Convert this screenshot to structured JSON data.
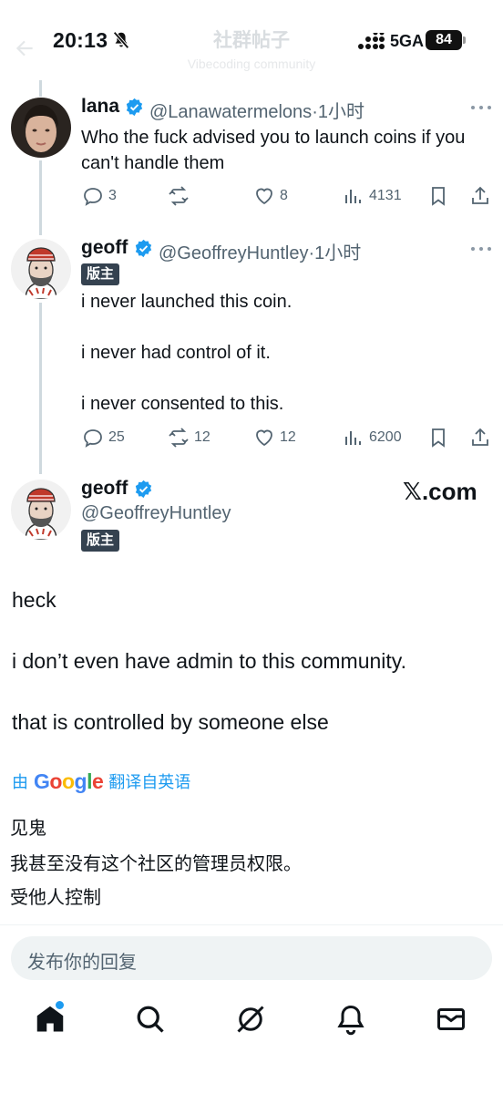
{
  "status_bar": {
    "time": "20:13",
    "network": "5GA",
    "battery": "84"
  },
  "header": {
    "title": "社群帖子",
    "subtitle": "Vibecoding community"
  },
  "tweets": [
    {
      "name": "lana",
      "handle": "@Lanawatermelons",
      "time": "·1小时",
      "text": "Who the fuck advised you to launch coins if you can't handle them",
      "actions": {
        "replies": "3",
        "reposts": "",
        "likes": "8",
        "views": "4131"
      }
    },
    {
      "name": "geoff",
      "handle": "@GeoffreyHuntley",
      "time": "·1小时",
      "badge": "版主",
      "lines": [
        "i never launched this coin.",
        "i never had control of it.",
        "i never consented to this."
      ],
      "actions": {
        "replies": "25",
        "reposts": "12",
        "likes": "12",
        "views": "6200"
      }
    }
  ],
  "main_post": {
    "name": "geoff",
    "handle": "@GeoffreyHuntley",
    "badge": "版主",
    "source": "𝕏.com",
    "lines": [
      "heck",
      "i don’t even have admin to this community.",
      "that is controlled by someone else"
    ],
    "translate": {
      "prefix": "由",
      "brand": "Google",
      "suffix": "翻译自英语"
    },
    "translation": [
      "见鬼",
      "我甚至没有这个社区的管理员权限。",
      "受他人控制"
    ]
  },
  "reply": {
    "placeholder": "发布你的回复"
  },
  "tabs": [
    "home-icon",
    "search-icon",
    "grok-icon",
    "notifications-icon",
    "messages-icon"
  ],
  "colors": {
    "accent": "#1d9bf0",
    "text": "#0f1419",
    "muted": "#536471",
    "badge": "#354250"
  }
}
